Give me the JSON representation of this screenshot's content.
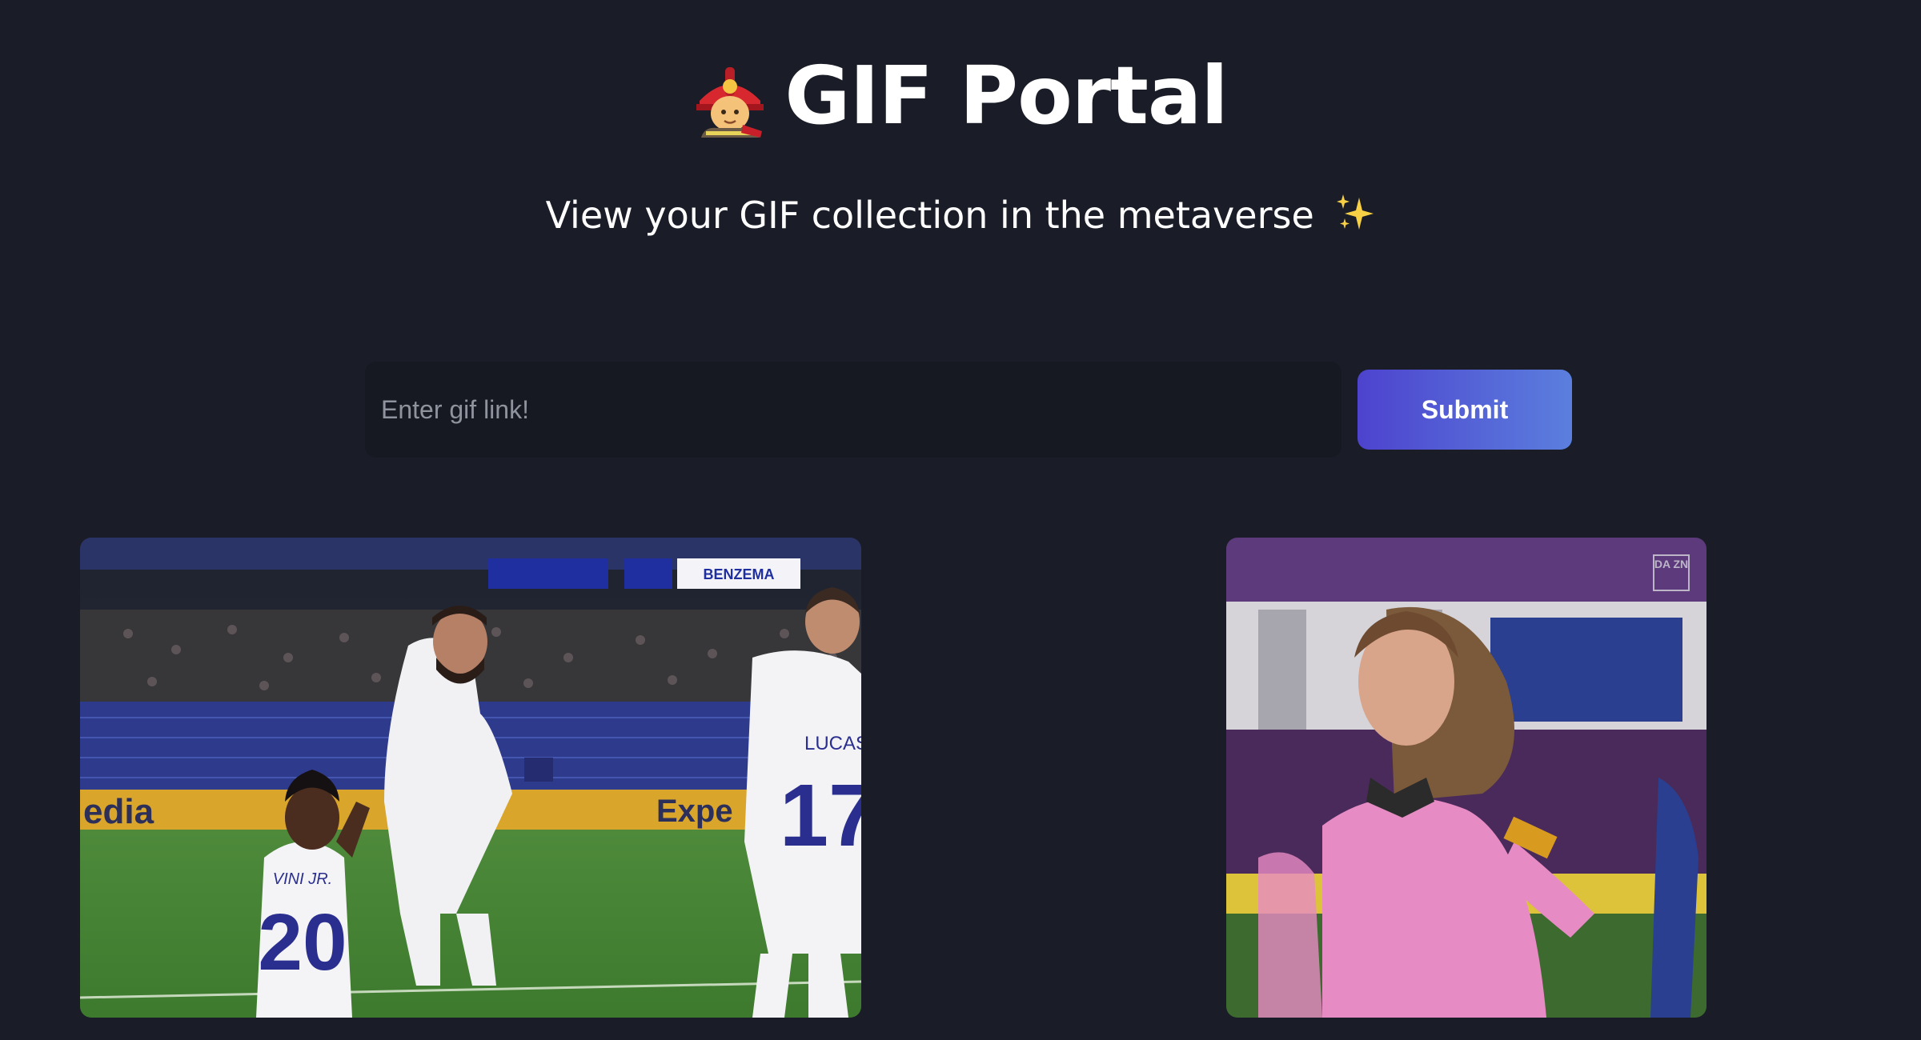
{
  "header": {
    "title": "GIF Portal",
    "title_icon": "firefighter-emoji",
    "subtitle": "View your GIF collection in the metaverse",
    "subtitle_icon": "sparkles-emoji"
  },
  "form": {
    "placeholder": "Enter gif link!",
    "value": "",
    "submit_label": "Submit",
    "submit_gradient": [
      "#4d43ce",
      "#5b7fde"
    ]
  },
  "gifs": {
    "first": {
      "scoreboard_name": "BENZEMA",
      "jersey_name_a": "VINI JR.",
      "jersey_number_a": "20",
      "jersey_name_b": "LUCAS",
      "jersey_number_b": "17",
      "ad_board_text_a": "edia",
      "ad_board_text_b": "Expe"
    },
    "second": {
      "watermark": "DA ZN"
    }
  },
  "colors": {
    "background": "#1a1d27",
    "input_background": "#161921",
    "text": "#ffffff"
  }
}
